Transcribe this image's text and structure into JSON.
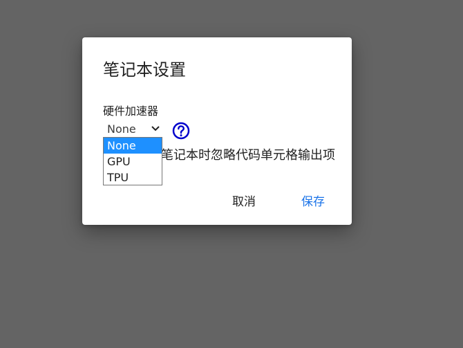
{
  "dialog": {
    "title": "笔记本设置",
    "hardware_accelerator": {
      "label": "硬件加速器",
      "selected": "None",
      "options": [
        "None",
        "GPU",
        "TPU"
      ]
    },
    "omit_output_label": "笔记本时忽略代码单元格输出项",
    "cancel_label": "取消",
    "save_label": "保存"
  },
  "colors": {
    "backdrop": "#646464",
    "accent": "#1a73e8",
    "selected_option": "#1e90ff",
    "help_icon": "#0000cc"
  },
  "icons": {
    "help": "help-circle-icon",
    "chevron": "chevron-down-icon"
  }
}
